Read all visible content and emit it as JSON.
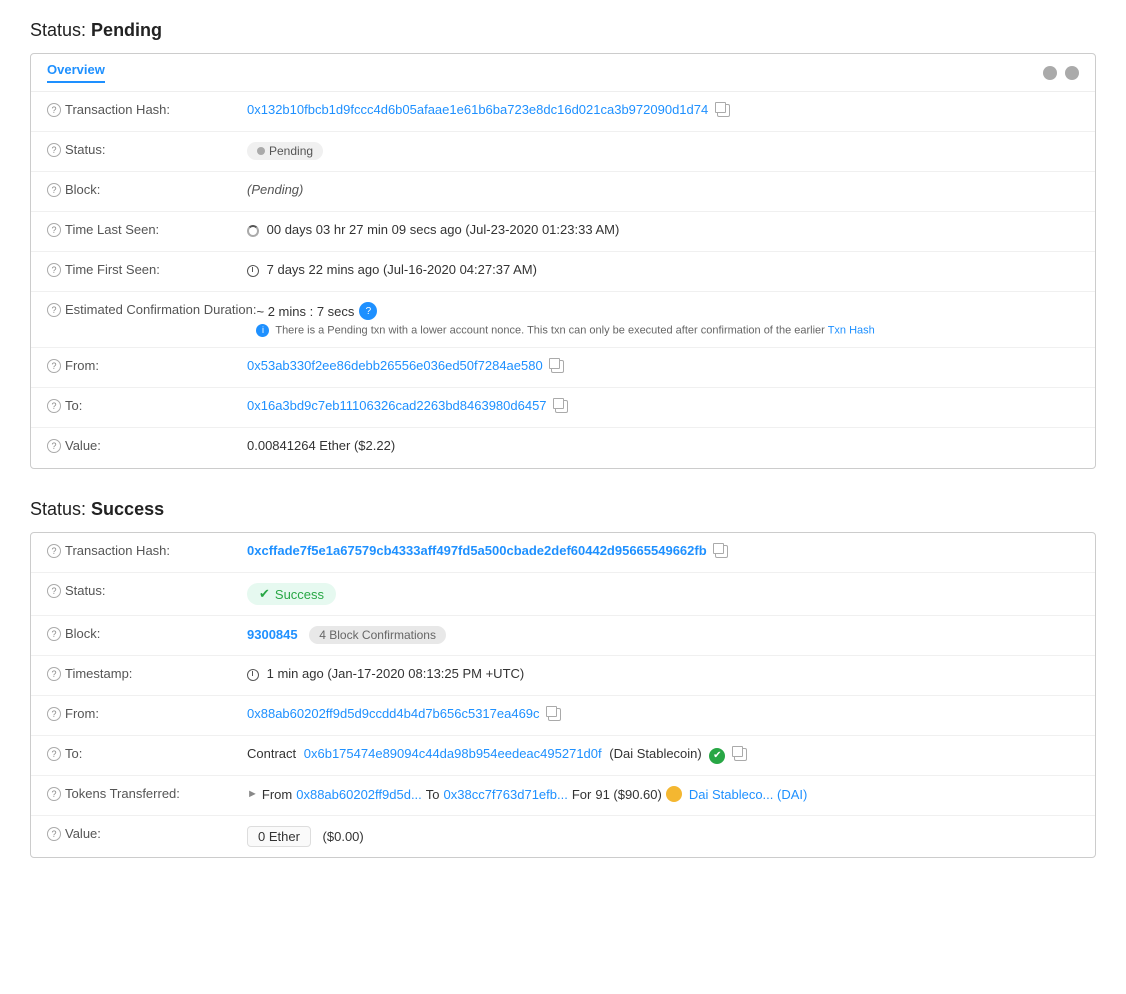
{
  "pending_section": {
    "title": "Status:",
    "status_word": "Pending",
    "tab_label": "Overview",
    "transaction_hash_label": "Transaction Hash:",
    "transaction_hash_value": "0x132b10fbcb1d9fccc4d6b05afaae1e61b6ba723e8dc16d021ca3b972090d1d74",
    "status_label": "Status:",
    "status_value": "Pending",
    "block_label": "Block:",
    "block_value": "(Pending)",
    "time_last_seen_label": "Time Last Seen:",
    "time_last_seen_value": "00 days 03 hr 27 min 09 secs ago (Jul-23-2020 01:23:33 AM)",
    "time_first_seen_label": "Time First Seen:",
    "time_first_seen_value": "7 days 22 mins ago (Jul-16-2020 04:27:37 AM)",
    "est_confirmation_label": "Estimated Confirmation Duration:",
    "est_confirmation_value": "~ 2 mins : 7 secs",
    "est_confirmation_note": "There is a Pending txn with a lower account nonce. This txn can only be executed after confirmation of the earlier Txn Hash",
    "txn_hash_link": "Txn Hash",
    "from_label": "From:",
    "from_value": "0x53ab330f2ee86debb26556e036ed50f7284ae580",
    "to_label": "To:",
    "to_value": "0x16a3bd9c7eb11106326cad2263bd8463980d6457",
    "value_label": "Value:",
    "value_value": "0.00841264 Ether ($2.22)"
  },
  "success_section": {
    "title": "Status:",
    "status_word": "Success",
    "transaction_hash_label": "Transaction Hash:",
    "transaction_hash_value": "0xcffade7f5e1a67579cb4333aff497fd5a500cbade2def60442d95665549662fb",
    "status_label": "Status:",
    "status_value": "Success",
    "block_label": "Block:",
    "block_number": "9300845",
    "block_confirmations": "4 Block Confirmations",
    "timestamp_label": "Timestamp:",
    "timestamp_value": "1 min ago (Jan-17-2020 08:13:25 PM +UTC)",
    "from_label": "From:",
    "from_value": "0x88ab60202ff9d5d9ccdd4b4d7b656c5317ea469c",
    "to_label": "To:",
    "to_contract_prefix": "Contract",
    "to_contract_address": "0x6b175474e89094c44da98b954eedeac495271d0f",
    "to_contract_name": "(Dai Stablecoin)",
    "tokens_transferred_label": "Tokens Transferred:",
    "tokens_from_label": "From",
    "tokens_from_address": "0x88ab60202ff9d5d...",
    "tokens_to_label": "To",
    "tokens_to_address": "0x38cc7f763d71efb...",
    "tokens_for_label": "For",
    "tokens_amount": "91 ($90.60)",
    "tokens_name": "Dai Stableco... (DAI)",
    "value_label": "Value:",
    "value_ether": "0 Ether",
    "value_usd": "($0.00)"
  }
}
